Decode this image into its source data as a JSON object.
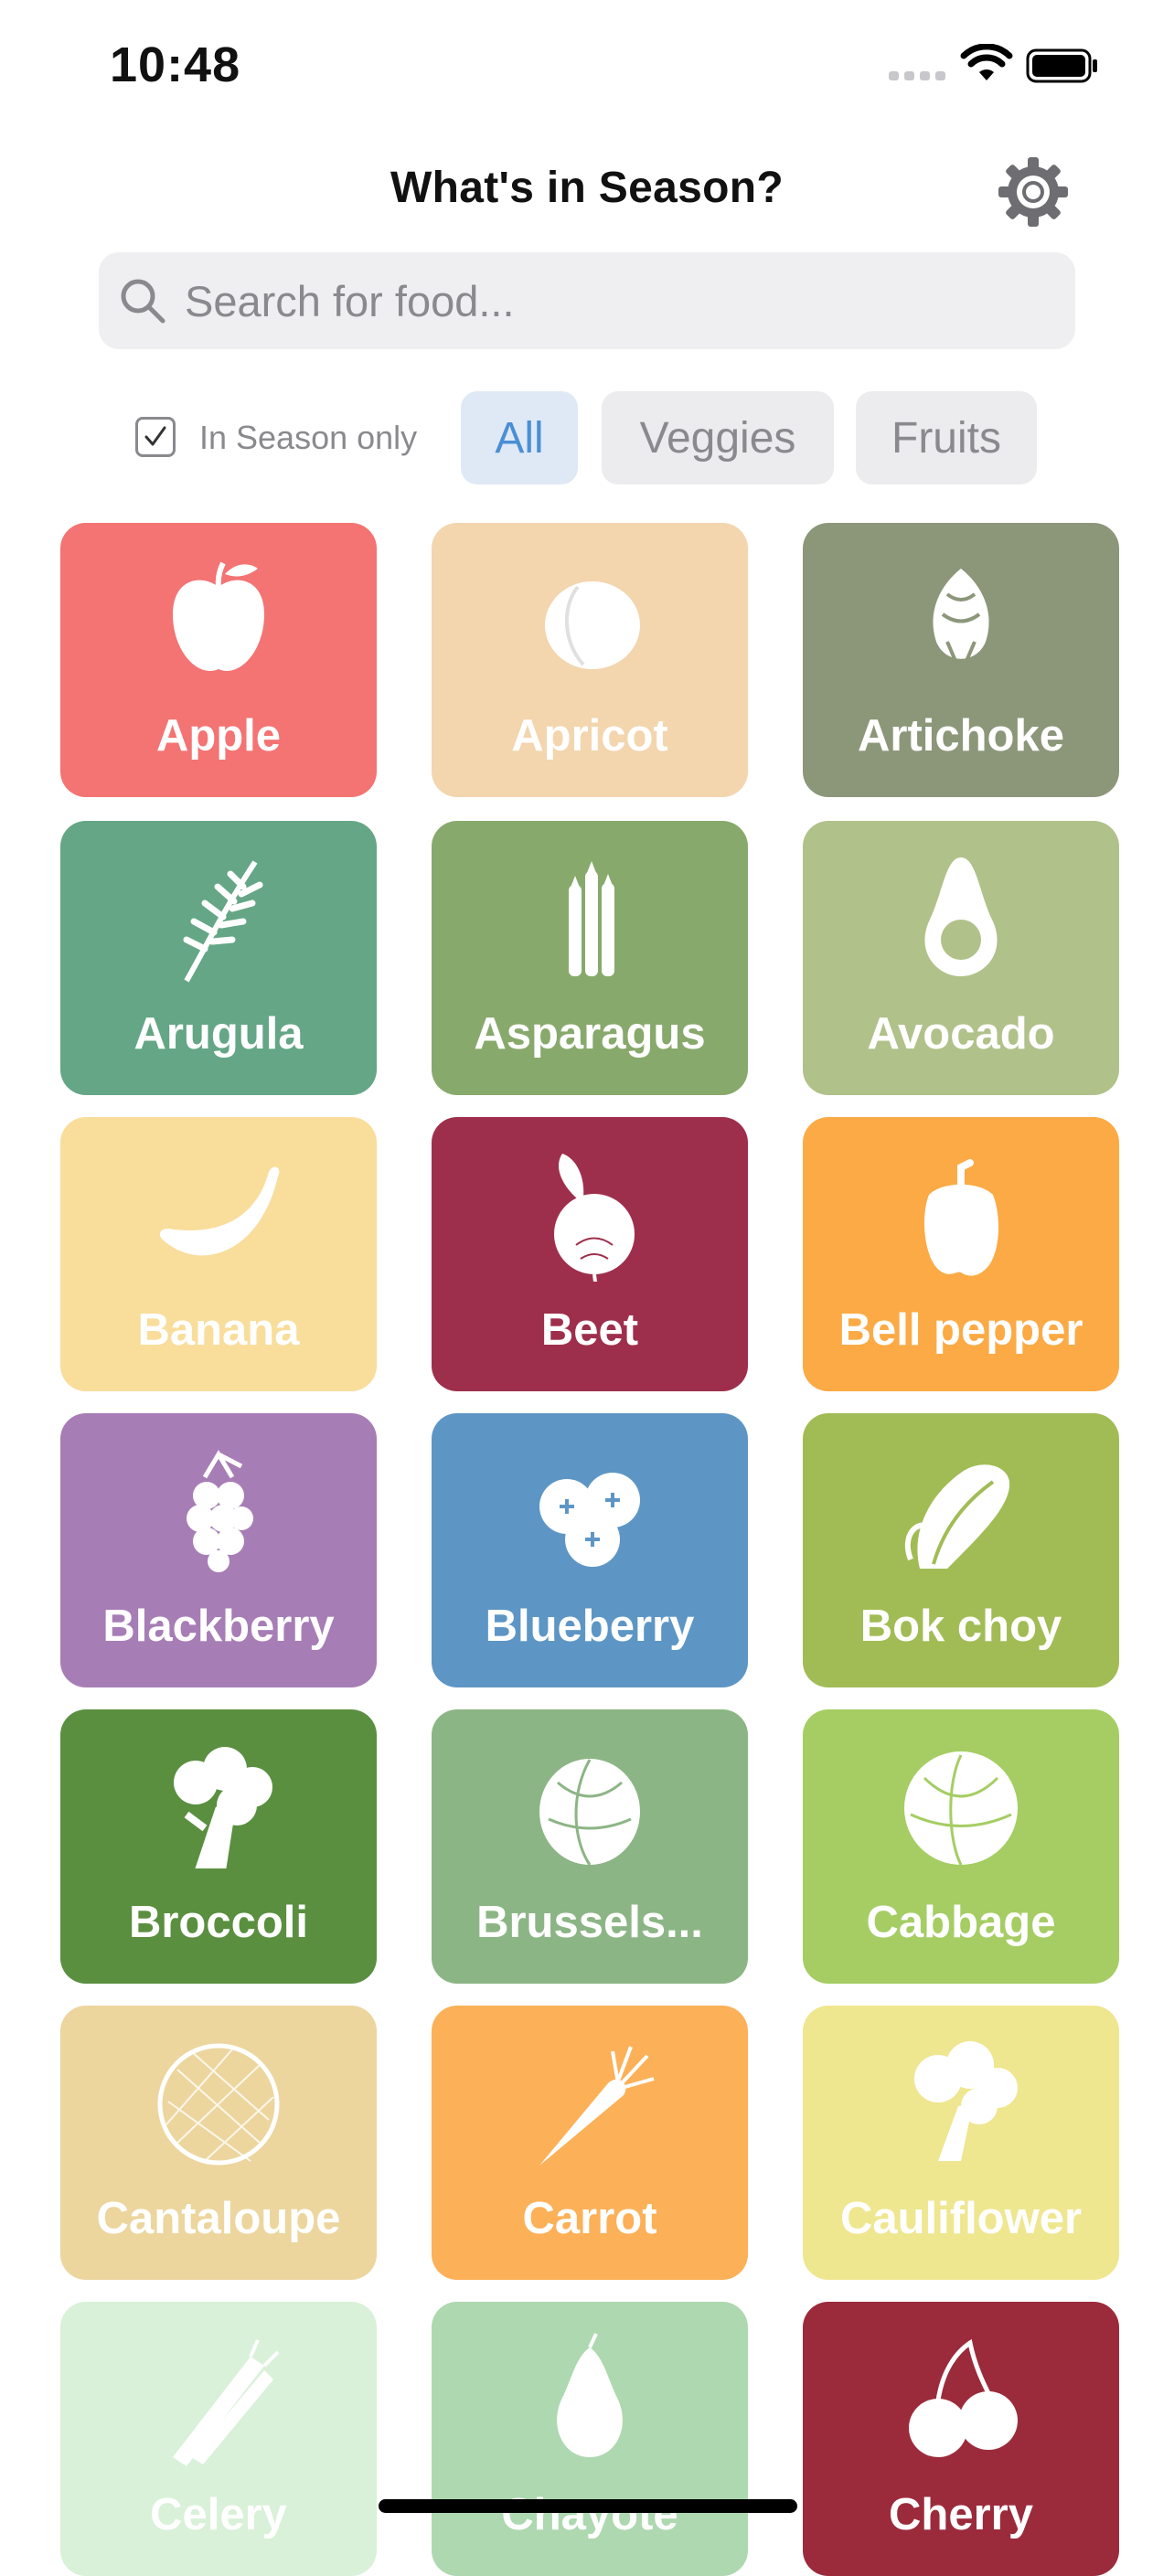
{
  "status_bar": {
    "time": "10:48"
  },
  "header": {
    "title": "What's in Season?",
    "settings_icon": "gear-icon"
  },
  "search": {
    "placeholder": "Search for food...",
    "value": ""
  },
  "filters": {
    "in_season_only": {
      "label": "In Season only",
      "checked": true
    },
    "tabs": [
      {
        "label": "All",
        "selected": true
      },
      {
        "label": "Veggies",
        "selected": false
      },
      {
        "label": "Fruits",
        "selected": false
      }
    ]
  },
  "colors": {
    "accent": "#4a8ed6"
  },
  "foods": [
    {
      "name": "Apple",
      "color": "#f47373",
      "icon": "apple-icon"
    },
    {
      "name": "Apricot",
      "color": "#f3d5ae",
      "icon": "apricot-icon"
    },
    {
      "name": "Artichoke",
      "color": "#8c977a",
      "icon": "artichoke-icon"
    },
    {
      "name": "Arugula",
      "color": "#64a685",
      "icon": "arugula-icon"
    },
    {
      "name": "Asparagus",
      "color": "#88a96c",
      "icon": "asparagus-icon"
    },
    {
      "name": "Avocado",
      "color": "#b1c18a",
      "icon": "avocado-icon"
    },
    {
      "name": "Banana",
      "color": "#f9dd9b",
      "icon": "banana-icon"
    },
    {
      "name": "Beet",
      "color": "#9e2f4c",
      "icon": "beet-icon"
    },
    {
      "name": "Bell pepper",
      "color": "#fcaa45",
      "icon": "bell-pepper-icon"
    },
    {
      "name": "Blackberry",
      "color": "#a77db6",
      "icon": "blackberry-icon"
    },
    {
      "name": "Blueberry",
      "color": "#5d96c5",
      "icon": "blueberry-icon"
    },
    {
      "name": "Bok choy",
      "color": "#a1bc55",
      "icon": "bok-choy-icon"
    },
    {
      "name": "Broccoli",
      "color": "#5a8f40",
      "icon": "broccoli-icon"
    },
    {
      "name": "Brussels...",
      "color": "#8cb585",
      "icon": "brussels-sprout-icon"
    },
    {
      "name": "Cabbage",
      "color": "#a5cd63",
      "icon": "cabbage-icon"
    },
    {
      "name": "Cantaloupe",
      "color": "#ecd69e",
      "icon": "cantaloupe-icon"
    },
    {
      "name": "Carrot",
      "color": "#fcb057",
      "icon": "carrot-icon"
    },
    {
      "name": "Cauliflower",
      "color": "#efe690",
      "icon": "cauliflower-icon"
    },
    {
      "name": "Celery",
      "color": "#d9f1d8",
      "icon": "celery-icon"
    },
    {
      "name": "Chayote",
      "color": "#aed8b0",
      "icon": "chayote-icon"
    },
    {
      "name": "Cherry",
      "color": "#9b2b3b",
      "icon": "cherry-icon"
    }
  ]
}
